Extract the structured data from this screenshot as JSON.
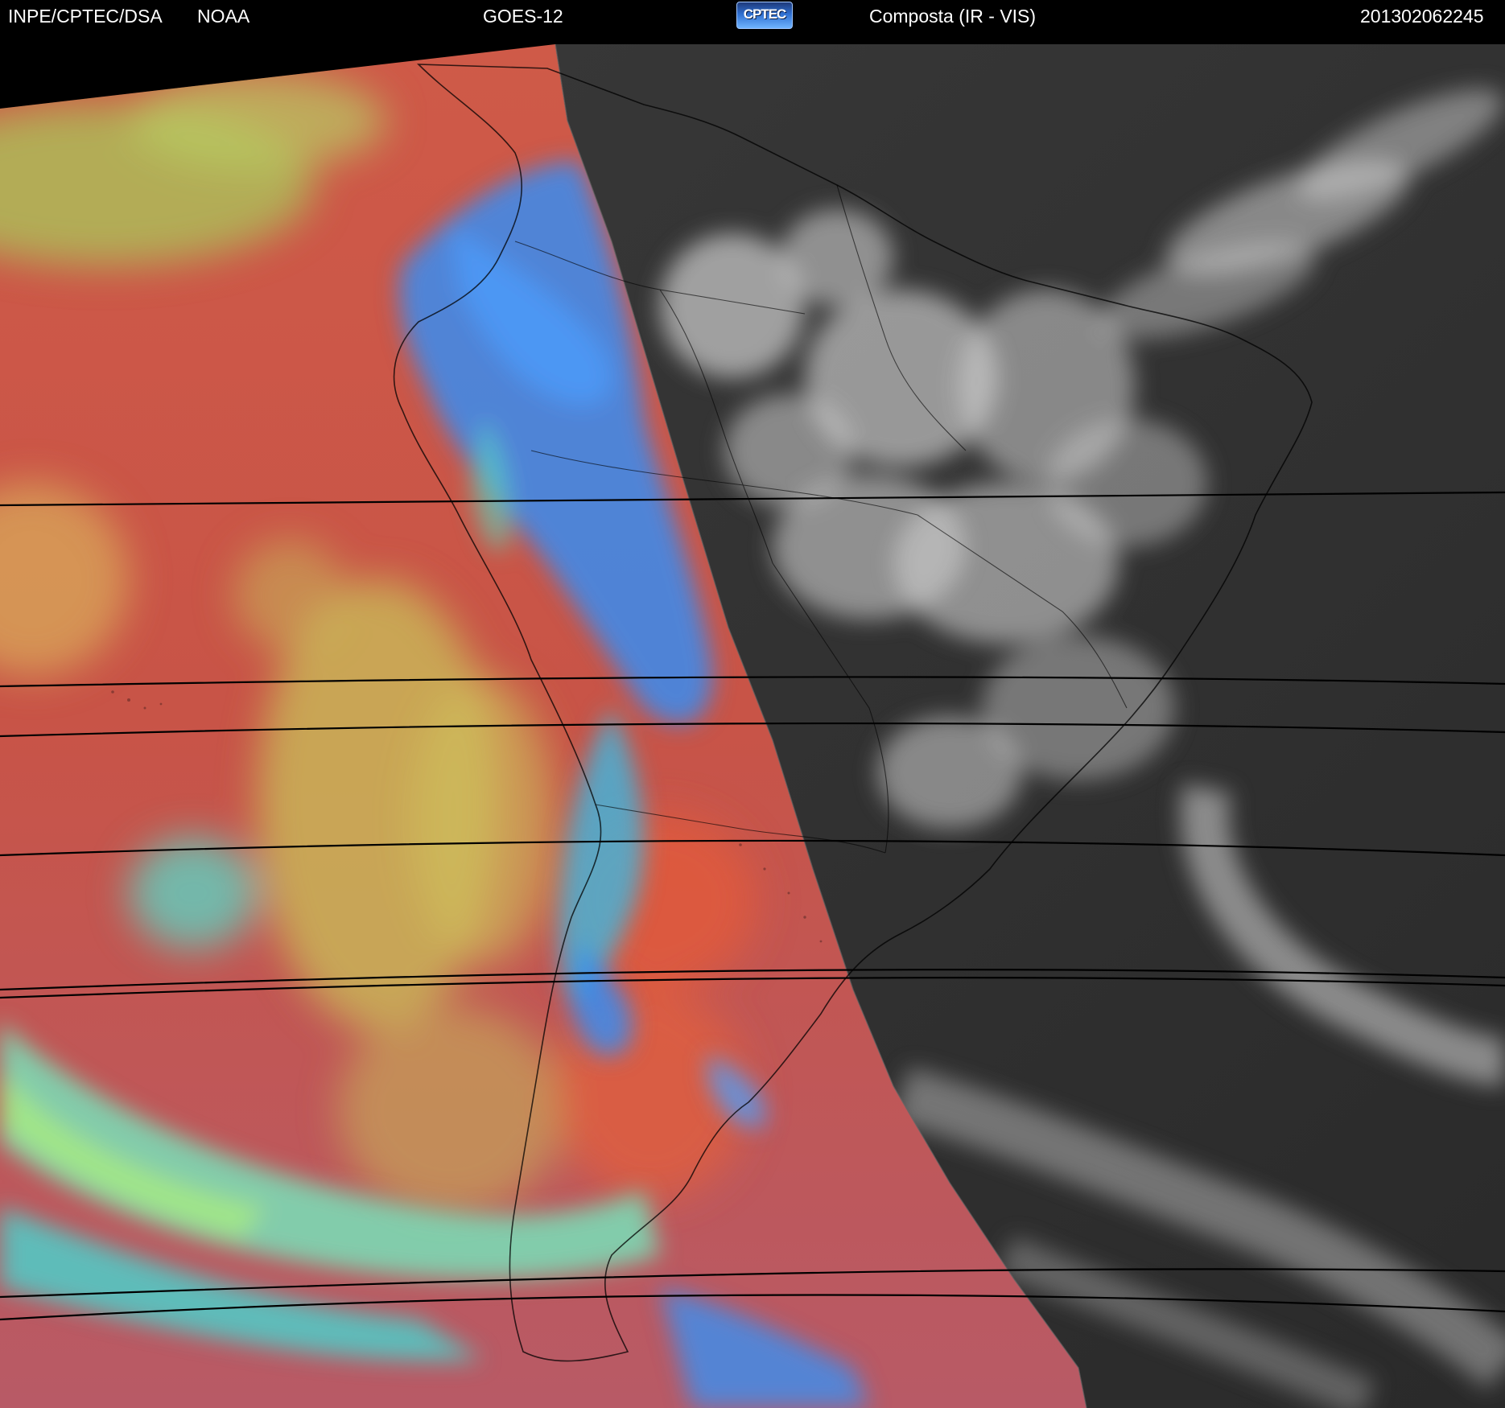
{
  "header": {
    "institution": "INPE/CPTEC/DSA",
    "agency": "NOAA",
    "satellite": "GOES-12",
    "logo_text": "CPTEC",
    "product": "Composta (IR - VIS)",
    "timestamp": "201302062245"
  },
  "colors": {
    "background": "#000000",
    "header_text": "#ffffff",
    "ir_ocean_red": "#c8564a",
    "ir_cloud_yellow": "#c8c45a",
    "ir_cloud_cyan": "#48d8c8",
    "ir_cloud_blue": "#3a8cf0",
    "vis_dark": "#2e2e2e",
    "vis_cloud": "#d8d8d8",
    "boundary": "#000000"
  },
  "icons": {
    "logo": "cptec-logo-icon"
  }
}
